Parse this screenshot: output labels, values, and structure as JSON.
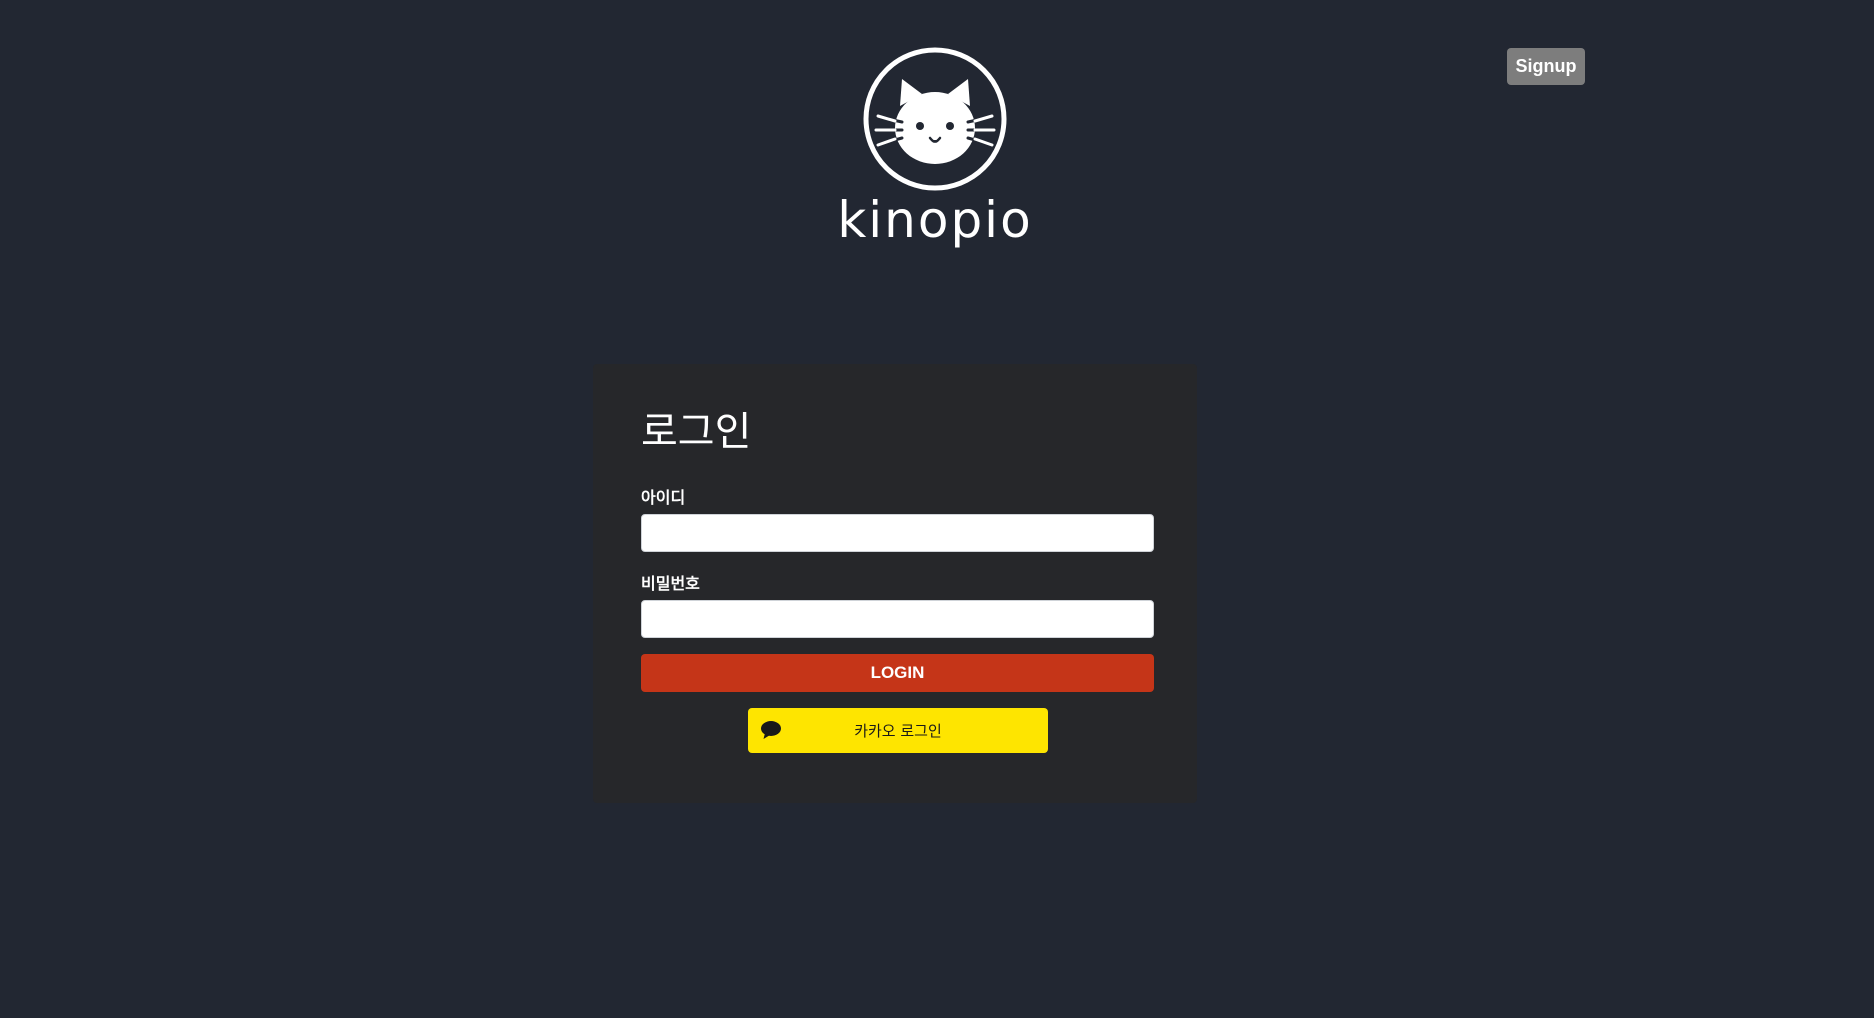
{
  "header": {
    "signup_label": "Signup"
  },
  "logo": {
    "icon": "cat-face-icon",
    "text": "kinopio"
  },
  "login_card": {
    "title": "로그인",
    "id_label": "아이디",
    "id_value": "",
    "password_label": "비밀번호",
    "password_value": "",
    "login_button_label": "LOGIN",
    "kakao_button_label": "카카오 로그인",
    "kakao_icon": "speech-bubble-icon"
  },
  "colors": {
    "background": "#222732",
    "card": "#26272a",
    "login_button": "#c53518",
    "kakao_button": "#fee500",
    "signup_button": "#7d7d7d"
  }
}
